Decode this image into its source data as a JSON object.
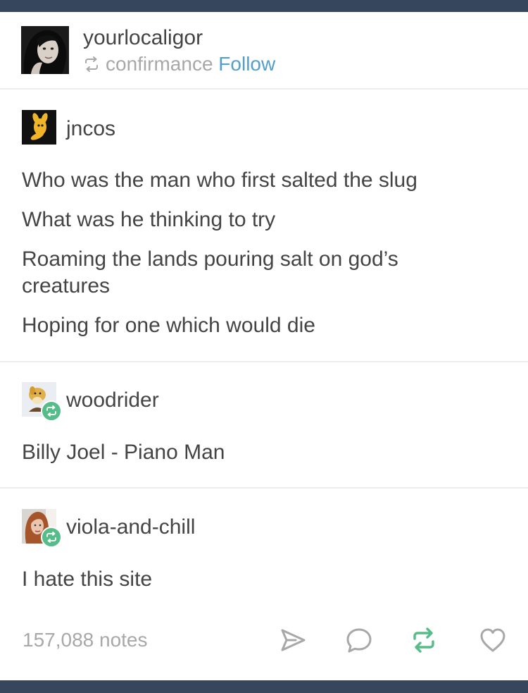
{
  "header": {
    "username": "yourlocaligor",
    "reblogged_from": "confirmance",
    "follow_label": "Follow"
  },
  "posts": [
    {
      "username": "jncos",
      "lines": [
        "Who was the man who first salted the slug",
        "What was he thinking to try",
        "Roaming the lands pouring salt on god’s creatures",
        "Hoping for one which would die"
      ]
    },
    {
      "username": "woodrider",
      "text": "Billy Joel - Piano Man"
    },
    {
      "username": "viola-and-chill",
      "text": "I hate this site"
    }
  ],
  "footer": {
    "notes": "157,088 notes",
    "icons": [
      "share-icon",
      "comment-icon",
      "reblog-icon",
      "like-icon"
    ]
  },
  "colors": {
    "nav": "#36465d",
    "reblog_green": "#56bc8a",
    "link_blue": "#529ecc",
    "muted_gray": "#a8a8a8"
  }
}
